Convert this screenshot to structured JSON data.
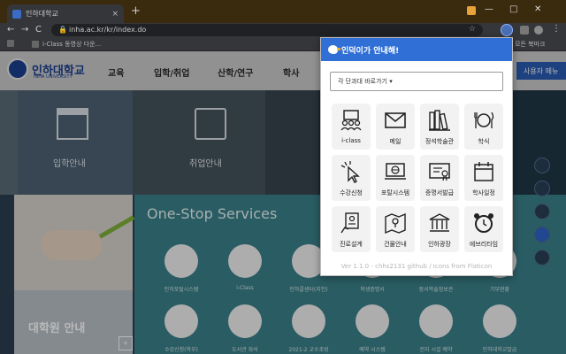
{
  "browser": {
    "tab_title": "인하대학교",
    "tab_close": "×",
    "new_tab": "+",
    "window_controls": {
      "minimize": "—",
      "maximize": "□",
      "close": "✕"
    },
    "nav": {
      "back": "←",
      "forward": "→",
      "reload": "C"
    },
    "url": "inha.ac.kr/kr/index.do",
    "bookmarks": {
      "apps": "",
      "iclass": "i-Class 동영상 다운...",
      "other": "모든 북마크"
    },
    "menu": "⋮",
    "colors": {
      "titlebar": "#3a2a0e",
      "toolbar": "#35363a"
    }
  },
  "site": {
    "logo_text": "인하대학교",
    "logo_sub": "INHA UNIVERSITY",
    "menu": [
      "교육",
      "입학/취업",
      "산학/연구",
      "학사"
    ],
    "right_button": "사용자 메뉴",
    "hero_tiles": [
      {
        "label": "입학안내",
        "icon": "building-icon"
      },
      {
        "label": "취업안내",
        "icon": "clipboard-icon"
      }
    ],
    "grad_title": "대학원 안내",
    "grad_button": "+",
    "onestop_title": "One-Stop Services",
    "onestop_items": [
      "인하포털시스템",
      "i-Class",
      "인하콜센터(지인)",
      "학생증명서",
      "장서학술정보관",
      "기부현황",
      "수강신청(학부)",
      "도서관 좌석",
      "2021-2 교수초빙",
      "예약 시스템",
      "전자 시설 예약",
      "인하대학교발급"
    ]
  },
  "popup": {
    "title": "인덕이가 안내해!",
    "dept_select": "각 단과대 바로가기 ▾",
    "items": [
      {
        "label": "i-class",
        "icon": "classroom-icon"
      },
      {
        "label": "메일",
        "icon": "mail-icon"
      },
      {
        "label": "정석학술관",
        "icon": "books-icon"
      },
      {
        "label": "학식",
        "icon": "meal-icon"
      },
      {
        "label": "수강신청",
        "icon": "cursor-click-icon"
      },
      {
        "label": "포탈시스템",
        "icon": "portal-icon"
      },
      {
        "label": "증명서발급",
        "icon": "certificate-icon"
      },
      {
        "label": "학사일정",
        "icon": "calendar-icon"
      },
      {
        "label": "진로설계",
        "icon": "career-icon"
      },
      {
        "label": "건물안내",
        "icon": "map-icon"
      },
      {
        "label": "인하광장",
        "icon": "plaza-icon"
      },
      {
        "label": "에브리타임",
        "icon": "alarm-clock-icon"
      }
    ],
    "footer": "Ver 1.1.0 - chhs2131 github / Icons from Flaticon",
    "colors": {
      "header": "#2f6fd6",
      "cell": "#f2f2f2"
    }
  }
}
